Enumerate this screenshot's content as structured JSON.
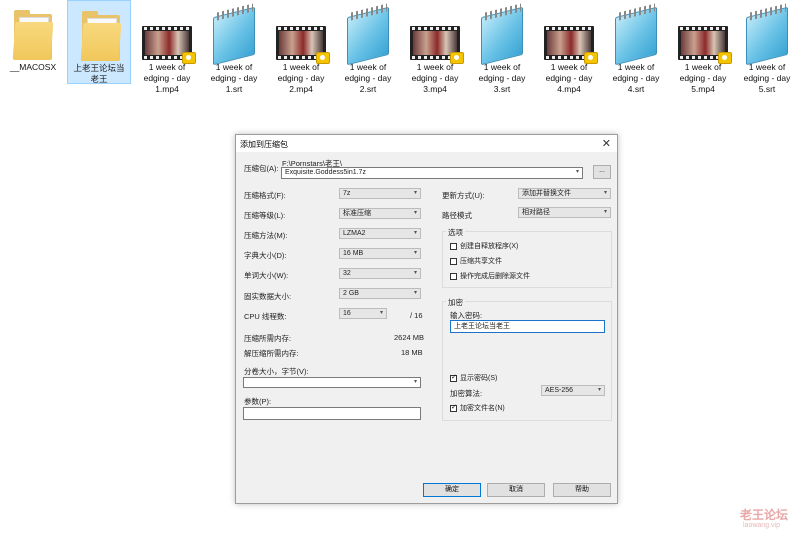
{
  "files": [
    {
      "name": "__MACOSX",
      "type": "folder",
      "selected": false
    },
    {
      "name": "上老王论坛当老王",
      "type": "folder",
      "selected": true
    },
    {
      "name": "1 week of edging - day 1.mp4",
      "type": "video",
      "line1": "1 week of",
      "line2": "edging - day",
      "line3": "1.mp4"
    },
    {
      "name": "1 week of edging - day 1.srt",
      "type": "srt",
      "line1": "1 week of",
      "line2": "edging - day",
      "line3": "1.srt"
    },
    {
      "name": "1 week of edging - day 2.mp4",
      "type": "video",
      "line1": "1 week of",
      "line2": "edging - day",
      "line3": "2.mp4"
    },
    {
      "name": "1 week of edging - day 2.srt",
      "type": "srt",
      "line1": "1 week of",
      "line2": "edging - day",
      "line3": "2.srt"
    },
    {
      "name": "1 week of edging - day 3.mp4",
      "type": "video",
      "line1": "1 week of",
      "line2": "edging - day",
      "line3": "3.mp4"
    },
    {
      "name": "1 week of edging - day 3.srt",
      "type": "srt",
      "line1": "1 week of",
      "line2": "edging - day",
      "line3": "3.srt"
    },
    {
      "name": "1 week of edging - day 4.mp4",
      "type": "video",
      "line1": "1 week of",
      "line2": "edging - day",
      "line3": "4.mp4"
    },
    {
      "name": "1 week of edging - day 4.srt",
      "type": "srt",
      "line1": "1 week of",
      "line2": "edging - day",
      "line3": "4.srt"
    },
    {
      "name": "1 week of edging - day 5.mp4",
      "type": "video",
      "line1": "1 week of",
      "line2": "edging - day",
      "line3": "5.mp4"
    },
    {
      "name": "1 week of edging - day 5.srt",
      "type": "srt",
      "line1": "1 week of",
      "line2": "edging - day",
      "line3": "5.srt"
    }
  ],
  "dialog": {
    "title": "添加到压缩包",
    "close": "✕",
    "archive_label": "压缩包(A):",
    "archive_path": "F:\\Pornstars\\老王\\",
    "archive_name": "Exquisite.Goddess5in1.7z",
    "browse": "...",
    "format_label": "压缩格式(F):",
    "format": "7z",
    "level_label": "压缩等级(L):",
    "level": "标准压缩",
    "method_label": "压缩方法(M):",
    "method": "LZMA2",
    "dict_label": "字典大小(D):",
    "dict": "16 MB",
    "word_label": "单词大小(W):",
    "word": "32",
    "solid_label": "固实数据大小:",
    "solid": "2 GB",
    "cpu_label": "CPU 线程数:",
    "cpu": "16",
    "cpu_total": "/ 16",
    "mem_comp_label": "压缩所需内存:",
    "mem_comp": "2624 MB",
    "mem_decomp_label": "解压缩所需内存:",
    "mem_decomp": "18 MB",
    "split_label": "分卷大小，字节(V):",
    "params_label": "参数(P):",
    "update_label": "更新方式(U):",
    "update": "添加并替换文件",
    "path_label": "路径模式",
    "path": "相对路径",
    "options_title": "选项",
    "opt_sfx": "创建自释放程序(X)",
    "opt_shared": "压缩共享文件",
    "opt_delete": "操作完成后删除源文件",
    "enc_title": "加密",
    "pwd_label": "输入密码:",
    "pwd_value": "上老王论坛当老王",
    "show_pwd": "显示密码(S)",
    "enc_method_label": "加密算法:",
    "enc_method": "AES-256",
    "enc_names": "加密文件名(N)",
    "ok": "确定",
    "cancel": "取消",
    "help": "帮助"
  },
  "watermark": {
    "name": "老王论坛",
    "url": "laowang.vip"
  }
}
